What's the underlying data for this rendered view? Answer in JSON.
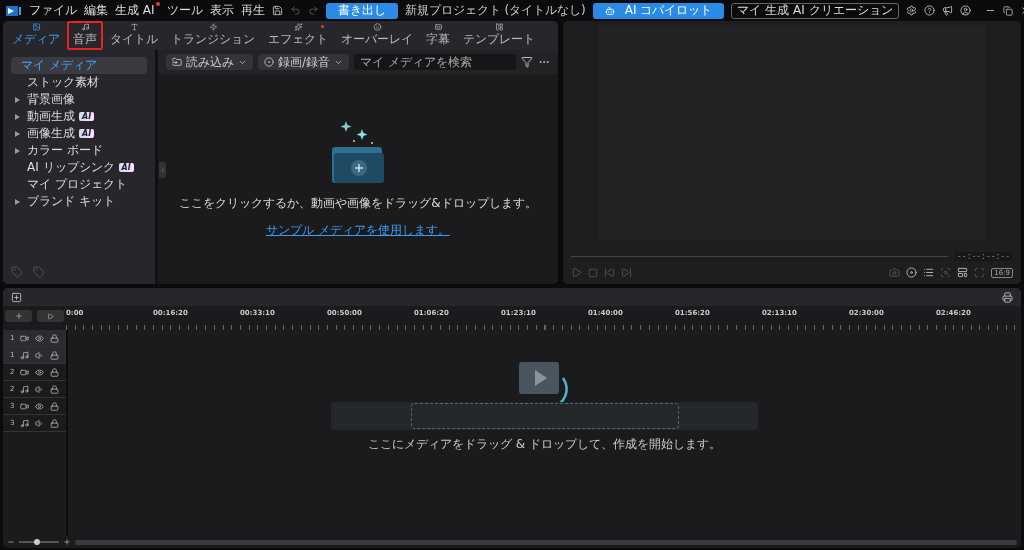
{
  "menu": [
    {
      "label": "ファイル",
      "dot": false
    },
    {
      "label": "編集",
      "dot": false
    },
    {
      "label": "生成 AI",
      "dot": true
    },
    {
      "label": "ツール",
      "dot": false
    },
    {
      "label": "表示",
      "dot": false
    },
    {
      "label": "再生",
      "dot": false
    }
  ],
  "export_button": "書き出し",
  "window_title": "新規プロジェクト (タイトルなし)",
  "copilot_button": "AI コパイロット",
  "creations_button": "マイ 生成 AI クリエーション",
  "tabs": [
    {
      "kind": "media",
      "label": "メディア",
      "selected": true,
      "highlighted": false,
      "dot": false
    },
    {
      "kind": "audio",
      "label": "音声",
      "selected": false,
      "highlighted": true,
      "dot": false
    },
    {
      "kind": "title",
      "label": "タイトル",
      "selected": false,
      "highlighted": false,
      "dot": false
    },
    {
      "kind": "transition",
      "label": "トランジション",
      "selected": false,
      "highlighted": false,
      "dot": false
    },
    {
      "kind": "effect",
      "label": "エフェクト",
      "selected": false,
      "highlighted": false,
      "dot": true
    },
    {
      "kind": "overlay",
      "label": "オーバーレイ",
      "selected": false,
      "highlighted": false,
      "dot": false
    },
    {
      "kind": "subtitle",
      "label": "字幕",
      "selected": false,
      "highlighted": false,
      "dot": false
    },
    {
      "kind": "template",
      "label": "テンプレート",
      "selected": false,
      "highlighted": false,
      "dot": false
    }
  ],
  "sidebar": {
    "items": [
      {
        "label": "マイ メディア",
        "selected": true,
        "expandable": false
      },
      {
        "label": "ストック素材",
        "selected": false,
        "expandable": false
      },
      {
        "label": "背景画像",
        "selected": false,
        "expandable": true
      },
      {
        "label": "動画生成",
        "selected": false,
        "expandable": true,
        "badge": "AI"
      },
      {
        "label": "画像生成",
        "selected": false,
        "expandable": true,
        "badge": "AI"
      },
      {
        "label": "カラー ボード",
        "selected": false,
        "expandable": true
      },
      {
        "label": "AI リップシンク",
        "selected": false,
        "expandable": false,
        "badge": "AI"
      },
      {
        "label": "マイ プロジェクト",
        "selected": false,
        "expandable": false
      },
      {
        "label": "ブランド キット",
        "selected": false,
        "expandable": true
      }
    ]
  },
  "media_toolbar": {
    "import_button": "読み込み",
    "record_button": "録画/録音",
    "search": {
      "placeholder": "マイ メディアを検索"
    }
  },
  "media_empty": {
    "message": "ここをクリックするか、動画や画像をドラッグ&ドロップします。",
    "link": "サンプル メディアを使用します。"
  },
  "preview": {
    "timecode": "--:--:--:--",
    "aspect_ratio": "16:9"
  },
  "timeline": {
    "ticks": [
      "0:00",
      "00:16:20",
      "00:33:10",
      "00:50:00",
      "01:06:20",
      "01:23:10",
      "01:40:00",
      "01:56:20",
      "02:13:10",
      "02:30:00",
      "02:46:20"
    ],
    "tracks": [
      {
        "number": "1",
        "kind": "video",
        "selected": true
      },
      {
        "number": "1",
        "kind": "audio",
        "selected": true
      },
      {
        "number": "2",
        "kind": "video",
        "selected": false
      },
      {
        "number": "2",
        "kind": "audio",
        "selected": false
      },
      {
        "number": "3",
        "kind": "video",
        "selected": false
      },
      {
        "number": "3",
        "kind": "audio",
        "selected": false
      }
    ],
    "drop_message": "ここにメディアをドラッグ & ドロップして、作成を開始します。",
    "zoom": {
      "level": 0.45
    }
  }
}
